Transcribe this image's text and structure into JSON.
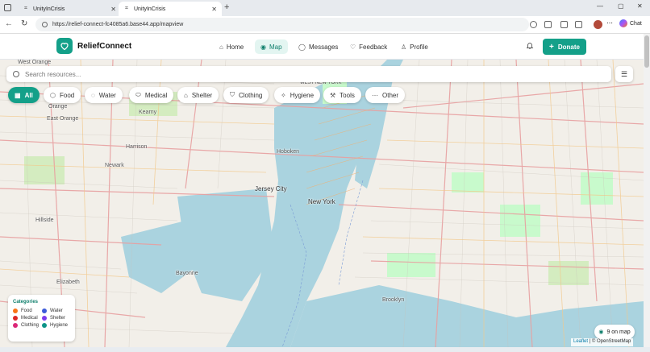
{
  "browser": {
    "tabs": [
      {
        "title": "UnityInCrisis"
      },
      {
        "title": "UnityInCrisis"
      }
    ],
    "url": "https://relief-connect-fc4085a6.base44.app/mapview",
    "chat_label": "Chat"
  },
  "header": {
    "brand": "ReliefConnect",
    "nav": [
      {
        "label": "Home",
        "icon": "home-icon"
      },
      {
        "label": "Map",
        "icon": "map-pin-icon"
      },
      {
        "label": "Messages",
        "icon": "message-icon"
      },
      {
        "label": "Feedback",
        "icon": "heart-icon"
      },
      {
        "label": "Profile",
        "icon": "user-icon"
      }
    ],
    "donate_label": "Donate"
  },
  "search": {
    "placeholder": "Search resources..."
  },
  "filters": [
    {
      "label": "All",
      "icon": "grid-icon"
    },
    {
      "label": "Food",
      "icon": "box-icon"
    },
    {
      "label": "Water",
      "icon": "droplet-icon"
    },
    {
      "label": "Medical",
      "icon": "pill-icon"
    },
    {
      "label": "Shelter",
      "icon": "house-icon"
    },
    {
      "label": "Clothing",
      "icon": "shirt-icon"
    },
    {
      "label": "Hygiene",
      "icon": "sparkle-icon"
    },
    {
      "label": "Tools",
      "icon": "wrench-icon"
    },
    {
      "label": "Other",
      "icon": "dots-icon"
    }
  ],
  "legend": {
    "title": "Categories",
    "items": [
      {
        "label": "Food",
        "color": "#f97316"
      },
      {
        "label": "Water",
        "color": "#3b5bd9"
      },
      {
        "label": "Medical",
        "color": "#dc2626"
      },
      {
        "label": "Shelter",
        "color": "#7c3aed"
      },
      {
        "label": "Clothing",
        "color": "#db2777"
      },
      {
        "label": "Hygiene",
        "color": "#0d9488"
      }
    ]
  },
  "map": {
    "count_label": "9 on map",
    "attribution_leaflet": "Leaflet",
    "attribution_osm": "| © OpenStreetMap",
    "labels": [
      {
        "text": "West Orange"
      },
      {
        "text": "Orange"
      },
      {
        "text": "East Orange"
      },
      {
        "text": "Kearny"
      },
      {
        "text": "Harrison"
      },
      {
        "text": "Newark"
      },
      {
        "text": "Hoboken"
      },
      {
        "text": "Jersey City"
      },
      {
        "text": "New York"
      },
      {
        "text": "Hillside"
      },
      {
        "text": "Elizabeth"
      },
      {
        "text": "Bayonne"
      },
      {
        "text": "Brooklyn"
      },
      {
        "text": "WEST NEW YORK"
      }
    ]
  }
}
